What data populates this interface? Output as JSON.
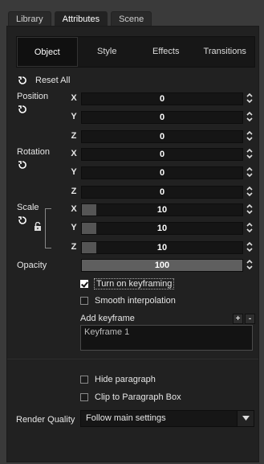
{
  "top_tabs": [
    "Library",
    "Attributes",
    "Scene"
  ],
  "sub_tabs": [
    "Object",
    "Style",
    "Effects",
    "Transitions"
  ],
  "reset_all": "Reset All",
  "position": {
    "label": "Position",
    "x": "0",
    "y": "0",
    "z": "0"
  },
  "rotation": {
    "label": "Rotation",
    "x": "0",
    "y": "0",
    "z": "0"
  },
  "scale": {
    "label": "Scale",
    "x": "10",
    "y": "10",
    "z": "10"
  },
  "opacity": {
    "label": "Opacity",
    "value": "100"
  },
  "axes": {
    "x": "X",
    "y": "Y",
    "z": "Z"
  },
  "keyframing": {
    "turn_on": "Turn on keyframing",
    "smooth": "Smooth interpolation"
  },
  "add_keyframe": {
    "label": "Add keyframe",
    "add": "+",
    "remove": "-",
    "items": [
      "Keyframe 1"
    ]
  },
  "hide_paragraph": "Hide paragraph",
  "clip_paragraph": "Clip to Paragraph Box",
  "render_quality": {
    "label": "Render Quality",
    "value": "Follow main settings"
  }
}
